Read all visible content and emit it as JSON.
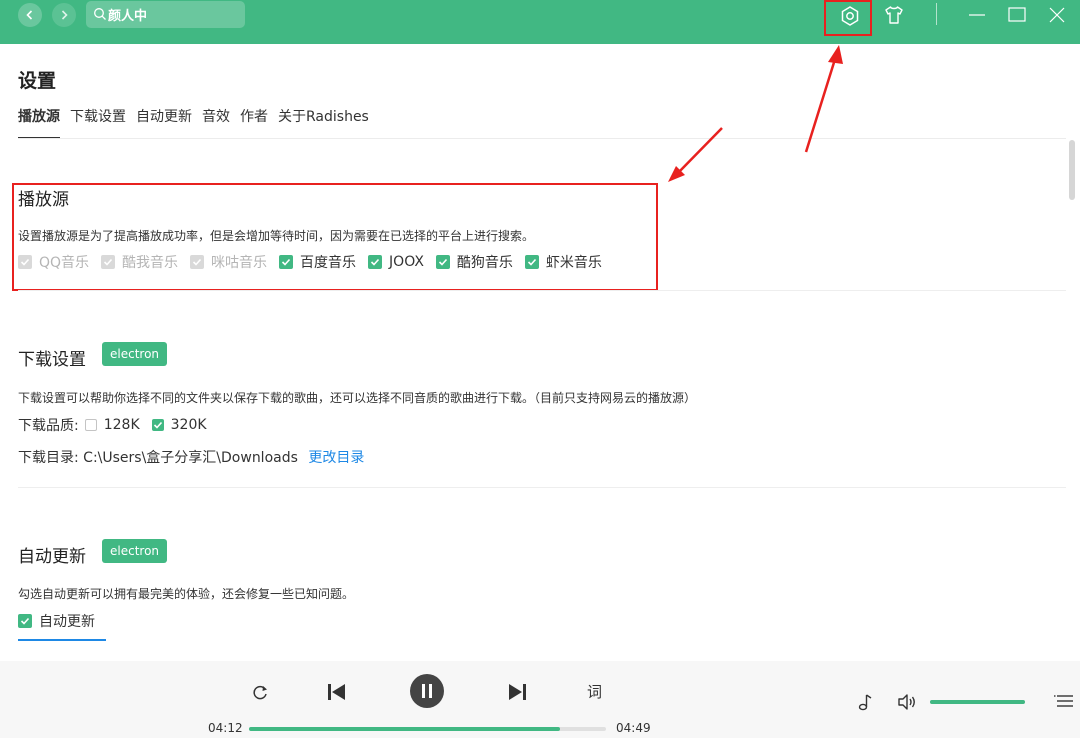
{
  "colors": {
    "accent": "#41b883",
    "highlight": "#e8211f",
    "link": "#1e88e5"
  },
  "topbar": {
    "search": {
      "value": "颜人中",
      "icon": "search-icon"
    },
    "icons": [
      "back-icon",
      "forward-icon",
      "settings-icon",
      "skin-icon",
      "minimize-icon",
      "maximize-icon",
      "close-icon"
    ]
  },
  "page": {
    "title": "设置",
    "tabs": [
      {
        "label": "播放源"
      },
      {
        "label": "下载设置"
      },
      {
        "label": "自动更新"
      },
      {
        "label": "音效"
      },
      {
        "label": "作者"
      },
      {
        "label": "关于Radishes"
      }
    ]
  },
  "source": {
    "title": "播放源",
    "desc": "设置播放源是为了提高播放成功率，但是会增加等待时间，因为需要在已选择的平台上进行搜索。",
    "options": [
      {
        "label": "QQ音乐",
        "checked": true,
        "disabled": true
      },
      {
        "label": "酷我音乐",
        "checked": true,
        "disabled": true
      },
      {
        "label": "咪咕音乐",
        "checked": true,
        "disabled": true
      },
      {
        "label": "百度音乐",
        "checked": true,
        "disabled": false
      },
      {
        "label": "JOOX",
        "checked": true,
        "disabled": false
      },
      {
        "label": "酷狗音乐",
        "checked": true,
        "disabled": false
      },
      {
        "label": "虾米音乐",
        "checked": true,
        "disabled": false
      }
    ]
  },
  "download": {
    "title": "下载设置",
    "badge": "electron",
    "desc": "下载设置可以帮助你选择不同的文件夹以保存下载的歌曲，还可以选择不同音质的歌曲进行下载。（目前只支持网易云的播放源）",
    "quality_label": "下载品质:",
    "qualities": [
      {
        "label": "128K",
        "checked": false
      },
      {
        "label": "320K",
        "checked": true
      }
    ],
    "dir_label": "下载目录:",
    "dir_value": "C:\\Users\\盒子分享汇\\Downloads",
    "change_dir": "更改目录"
  },
  "update": {
    "title": "自动更新",
    "badge": "electron",
    "desc": "勾选自动更新可以拥有最完美的体验，还会修复一些已知问题。",
    "option": {
      "label": "自动更新",
      "checked": true
    }
  },
  "player": {
    "current_time": "04:12",
    "total_time": "04:49",
    "progress": 0.872,
    "volume": 1.0,
    "lyrics_label": "词",
    "icons": [
      "repeat-icon",
      "prev-icon",
      "pause-icon",
      "next-icon",
      "music-note-icon",
      "volume-icon",
      "playlist-icon"
    ]
  }
}
